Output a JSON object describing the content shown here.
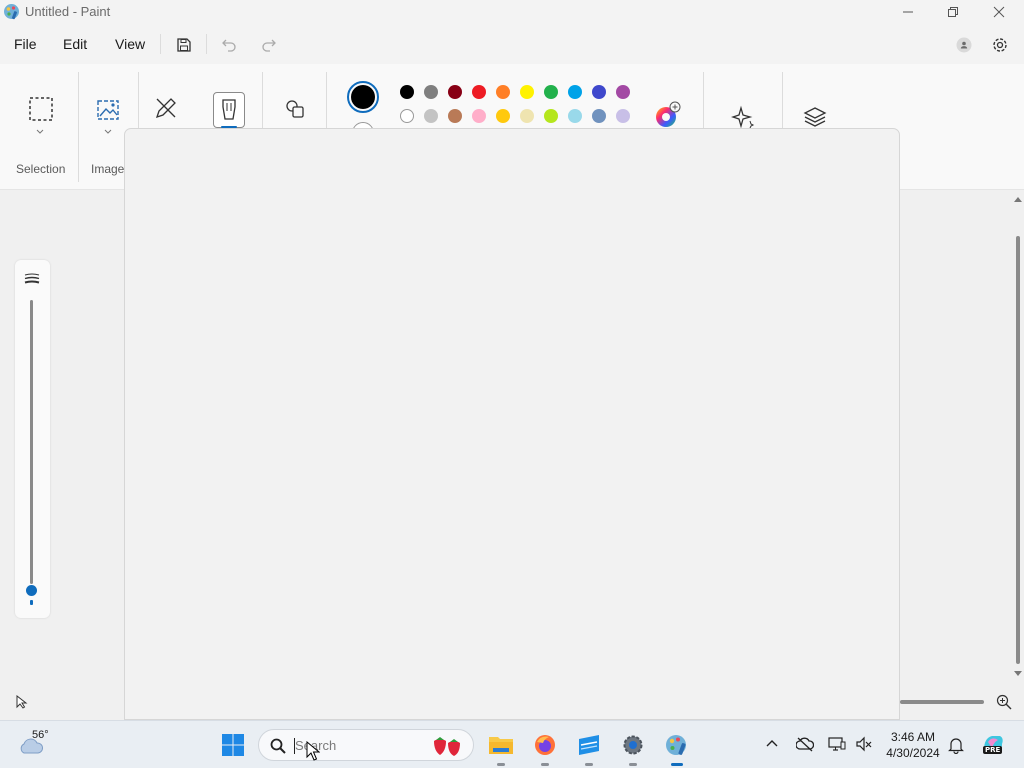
{
  "window": {
    "title": "Untitled - Paint"
  },
  "menu": {
    "file": "File",
    "edit": "Edit",
    "view": "View"
  },
  "ribbon": {
    "selection_label": "Selection",
    "image_label": "Image"
  },
  "palette": {
    "current_color": "#000000",
    "row1": [
      "#000000",
      "#7f7f7f",
      "#880015",
      "#ed1c24",
      "#ff7f27",
      "#fff200",
      "#22b14c",
      "#00a2e8",
      "#3f48cc",
      "#a349a4"
    ],
    "row2": [
      "#ffffff",
      "#c3c3c3",
      "#b97a57",
      "#ffaec9",
      "#ffc90e",
      "#efe4b0",
      "#b5e61d",
      "#99d9ea",
      "#7092be",
      "#c8bfe7"
    ]
  },
  "taskbar": {
    "weather_temp": "56°",
    "search_placeholder": "Search",
    "time": "3:46 AM",
    "date": "4/30/2024"
  },
  "colors": {
    "accent": "#0f6cbd"
  }
}
